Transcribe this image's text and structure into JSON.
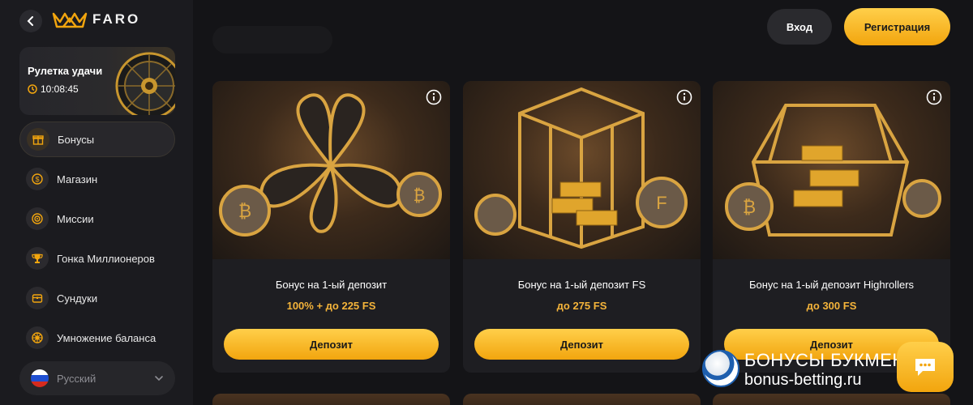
{
  "brand": {
    "name": "FARO"
  },
  "roulette": {
    "title": "Рулетка удачи",
    "timer": "10:08:45"
  },
  "sidebar": {
    "items": [
      {
        "label": "Бонусы",
        "icon": "gift-icon",
        "active": true
      },
      {
        "label": "Магазин",
        "icon": "coin-icon"
      },
      {
        "label": "Миссии",
        "icon": "target-icon"
      },
      {
        "label": "Гонка Миллионеров",
        "icon": "trophy-icon"
      },
      {
        "label": "Сундуки",
        "icon": "chest-icon"
      },
      {
        "label": "Умножение баланса",
        "icon": "multiply-icon"
      }
    ],
    "language": {
      "label": "Русский",
      "flag": "russia-flag-icon"
    }
  },
  "header": {
    "login_label": "Вход",
    "register_label": "Регистрация"
  },
  "cards": [
    {
      "title": "Бонус на 1-ый депозит",
      "amount": "100% + до 225 FS",
      "button": "Депозит",
      "image": "clover-with-coins"
    },
    {
      "title": "Бонус на 1-ый депозит FS",
      "amount": "до 275 FS",
      "button": "Депозит",
      "image": "glass-box-gold-bars"
    },
    {
      "title": "Бонус на 1-ый депозит Highrollers",
      "amount": "до 300 FS",
      "button": "Депозит",
      "image": "glass-chest-gold-bars"
    }
  ],
  "watermark": {
    "line1": "БОНУСЫ БУКМЕКЕРОВ",
    "line2": "bonus-betting.ru"
  },
  "colors": {
    "accent": "#f5b43a",
    "button_gradient_top": "#ffcf4a",
    "button_gradient_bottom": "#f2a50e",
    "background": "#141417",
    "sidebar": "#1b1b1f"
  }
}
